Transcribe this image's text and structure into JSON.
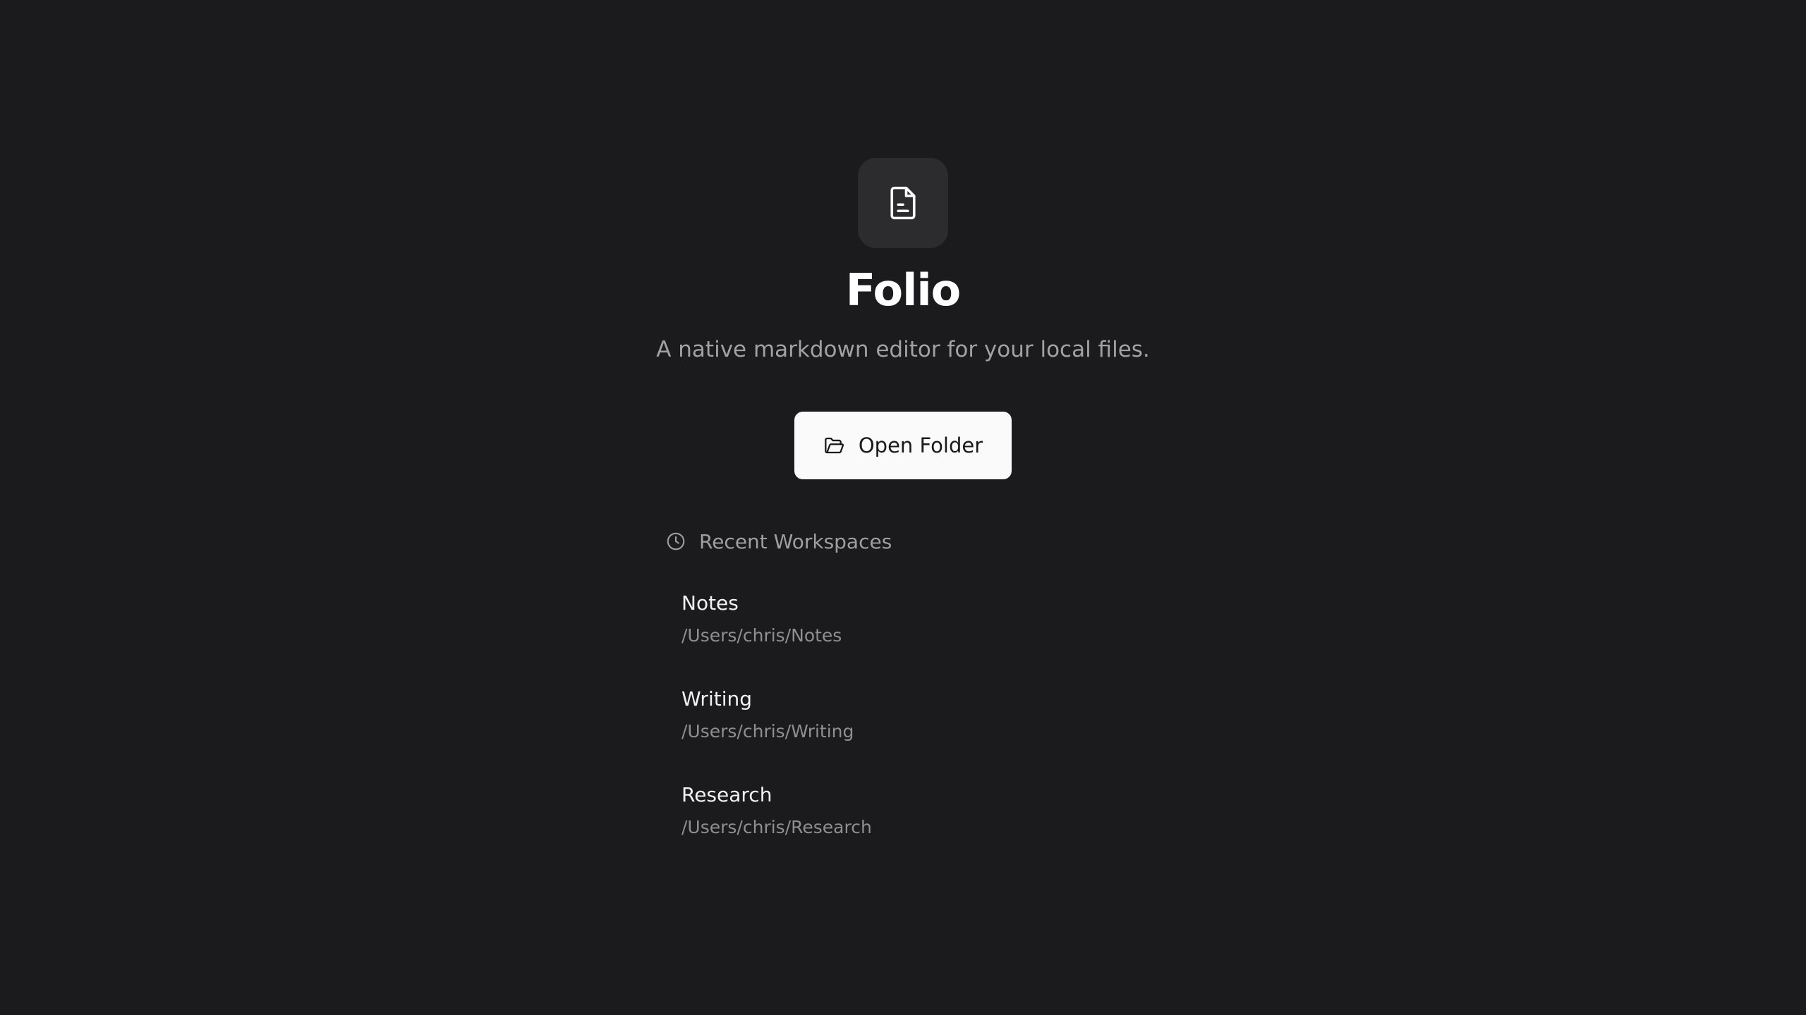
{
  "app": {
    "icon": "document-icon",
    "title": "Folio",
    "tagline": "A native markdown editor for your local files."
  },
  "actions": {
    "open_folder": {
      "icon": "folder-open-icon",
      "label": "Open Folder"
    }
  },
  "recent": {
    "icon": "clock-icon",
    "heading": "Recent Workspaces",
    "items": [
      {
        "name": "Notes",
        "path": "/Users/chris/Notes"
      },
      {
        "name": "Writing",
        "path": "/Users/chris/Writing"
      },
      {
        "name": "Research",
        "path": "/Users/chris/Research"
      }
    ]
  },
  "colors": {
    "background": "#1b1b1d",
    "icon_tile": "#2c2c2f",
    "button_background": "#fafafa",
    "title_text": "#ffffff",
    "secondary_text": "#a1a1a6"
  }
}
